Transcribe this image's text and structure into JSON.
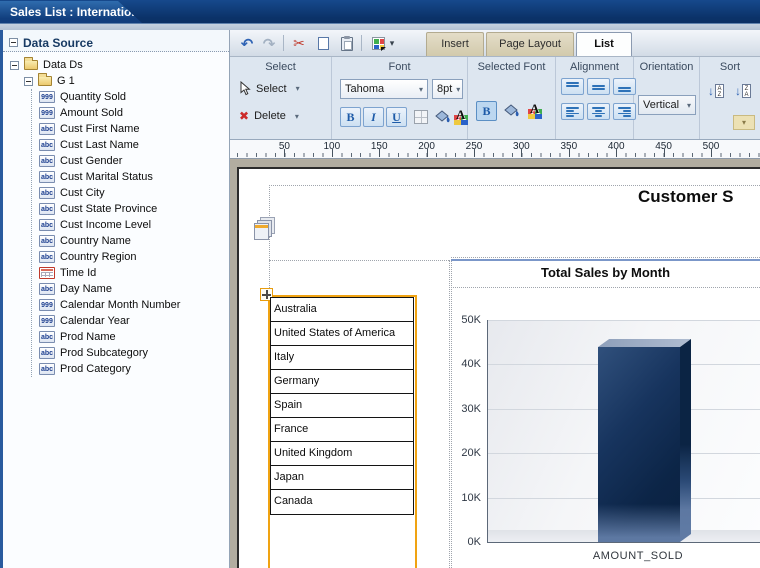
{
  "window": {
    "title": "Sales List : International Sales"
  },
  "sidebar": {
    "header": "Data Source",
    "tree": {
      "root_label": "Data Ds",
      "group_label": "G 1",
      "icon_glyphs": {
        "numeric": "999",
        "text": "abc"
      },
      "fields": [
        {
          "type": "numeric",
          "label": "Quantity Sold"
        },
        {
          "type": "numeric",
          "label": "Amount Sold"
        },
        {
          "type": "text",
          "label": "Cust First Name"
        },
        {
          "type": "text",
          "label": "Cust Last Name"
        },
        {
          "type": "text",
          "label": "Cust Gender"
        },
        {
          "type": "text",
          "label": "Cust Marital Status"
        },
        {
          "type": "text",
          "label": "Cust City"
        },
        {
          "type": "text",
          "label": "Cust State Province"
        },
        {
          "type": "text",
          "label": "Cust Income Level"
        },
        {
          "type": "text",
          "label": "Country Name"
        },
        {
          "type": "text",
          "label": "Country Region"
        },
        {
          "type": "date",
          "label": "Time Id"
        },
        {
          "type": "text",
          "label": "Day Name"
        },
        {
          "type": "numeric",
          "label": "Calendar Month Number"
        },
        {
          "type": "numeric",
          "label": "Calendar Year"
        },
        {
          "type": "text",
          "label": "Prod Name"
        },
        {
          "type": "text",
          "label": "Prod Subcategory"
        },
        {
          "type": "text",
          "label": "Prod Category"
        }
      ]
    }
  },
  "toolbar": {
    "tabs": [
      {
        "label": "Insert",
        "active": false
      },
      {
        "label": "Page Layout",
        "active": false
      },
      {
        "label": "List",
        "active": true
      }
    ],
    "groups": {
      "select": {
        "label": "Select",
        "select_button": "Select",
        "delete_button": "Delete"
      },
      "font": {
        "label": "Font",
        "font_name": "Tahoma",
        "font_size": "8pt",
        "bold": "B",
        "italic": "I",
        "underline": "U"
      },
      "selected_font": {
        "label": "Selected Font",
        "bold": "B"
      },
      "alignment": {
        "label": "Alignment"
      },
      "orientation": {
        "label": "Orientation",
        "value": "Vertical"
      },
      "sort": {
        "label": "Sort",
        "asc_letters": "AZ",
        "desc_letters": "ZA"
      }
    }
  },
  "ruler": {
    "ticks": [
      50,
      100,
      150,
      200,
      250,
      300,
      350,
      400,
      450,
      500
    ]
  },
  "canvas": {
    "report_title": "Customer S",
    "list_rows": [
      "Australia",
      "United States of America",
      "Italy",
      "Germany",
      "Spain",
      "France",
      "United Kingdom",
      "Japan",
      "Canada"
    ]
  },
  "chart_data": {
    "type": "bar",
    "title": "Total Sales by Month",
    "categories": [
      "AMOUNT_SOLD"
    ],
    "values": [
      44000
    ],
    "xlabel": "",
    "ylabel": "",
    "ylim": [
      0,
      50000
    ],
    "yticks": [
      {
        "value": 50000,
        "label": "50K"
      },
      {
        "value": 40000,
        "label": "40K"
      },
      {
        "value": 30000,
        "label": "30K"
      },
      {
        "value": 20000,
        "label": "20K"
      },
      {
        "value": 10000,
        "label": "10K"
      },
      {
        "value": 0,
        "label": "0K"
      }
    ],
    "grid": true,
    "legend": "none",
    "bar_color": "#12315e"
  },
  "colors": {
    "titlebar": "#0d3c78",
    "selection_accent": "#f0a312",
    "tab_active_bg": "#fdfefe",
    "tab_inactive_bg": "#d8d1ba",
    "ribbon_bg": "#dde6f0",
    "chart_bar": "#12315e",
    "chart_cell_line": "#7b97c9"
  }
}
